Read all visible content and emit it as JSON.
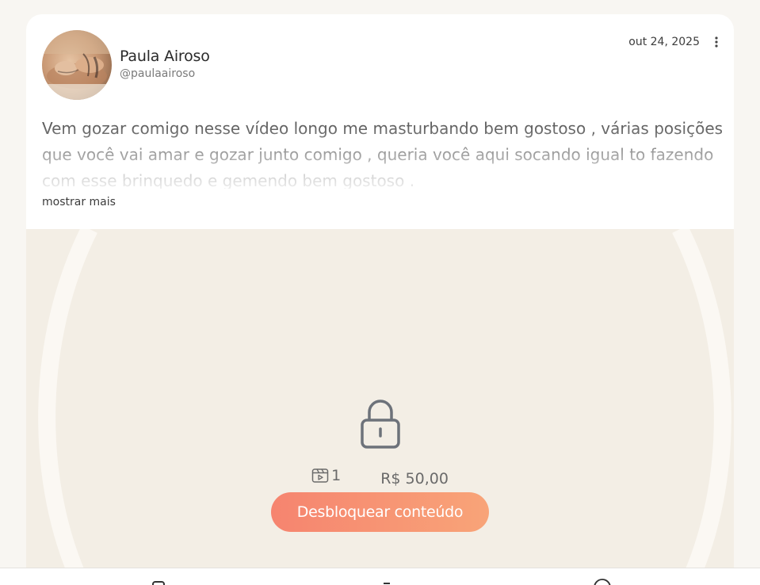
{
  "post": {
    "author": {
      "name": "Paula Airoso",
      "handle": "@paulaairoso"
    },
    "date": "out 24, 2025",
    "text": "Vem gozar comigo nesse vídeo longo me masturbando bem gostoso , várias posições que você vai amar e gozar junto comigo , queria você aqui socando igual to fazendo com esse brinquedo e gemendo bem gostoso .",
    "show_more_label": "mostrar mais",
    "locked_media": {
      "video_count": "1",
      "price": "R$ 50,00",
      "unlock_label": "Desbloquear conteúdo"
    }
  },
  "colors": {
    "accent_start": "#f6846f",
    "accent_end": "#f8a478",
    "media_background": "#f3eee5"
  },
  "icons": {
    "more": "vertical-dots-icon",
    "lock": "lock-icon",
    "video": "video-icon",
    "nav": [
      "home-icon",
      "add-icon",
      "profile-icon"
    ]
  }
}
